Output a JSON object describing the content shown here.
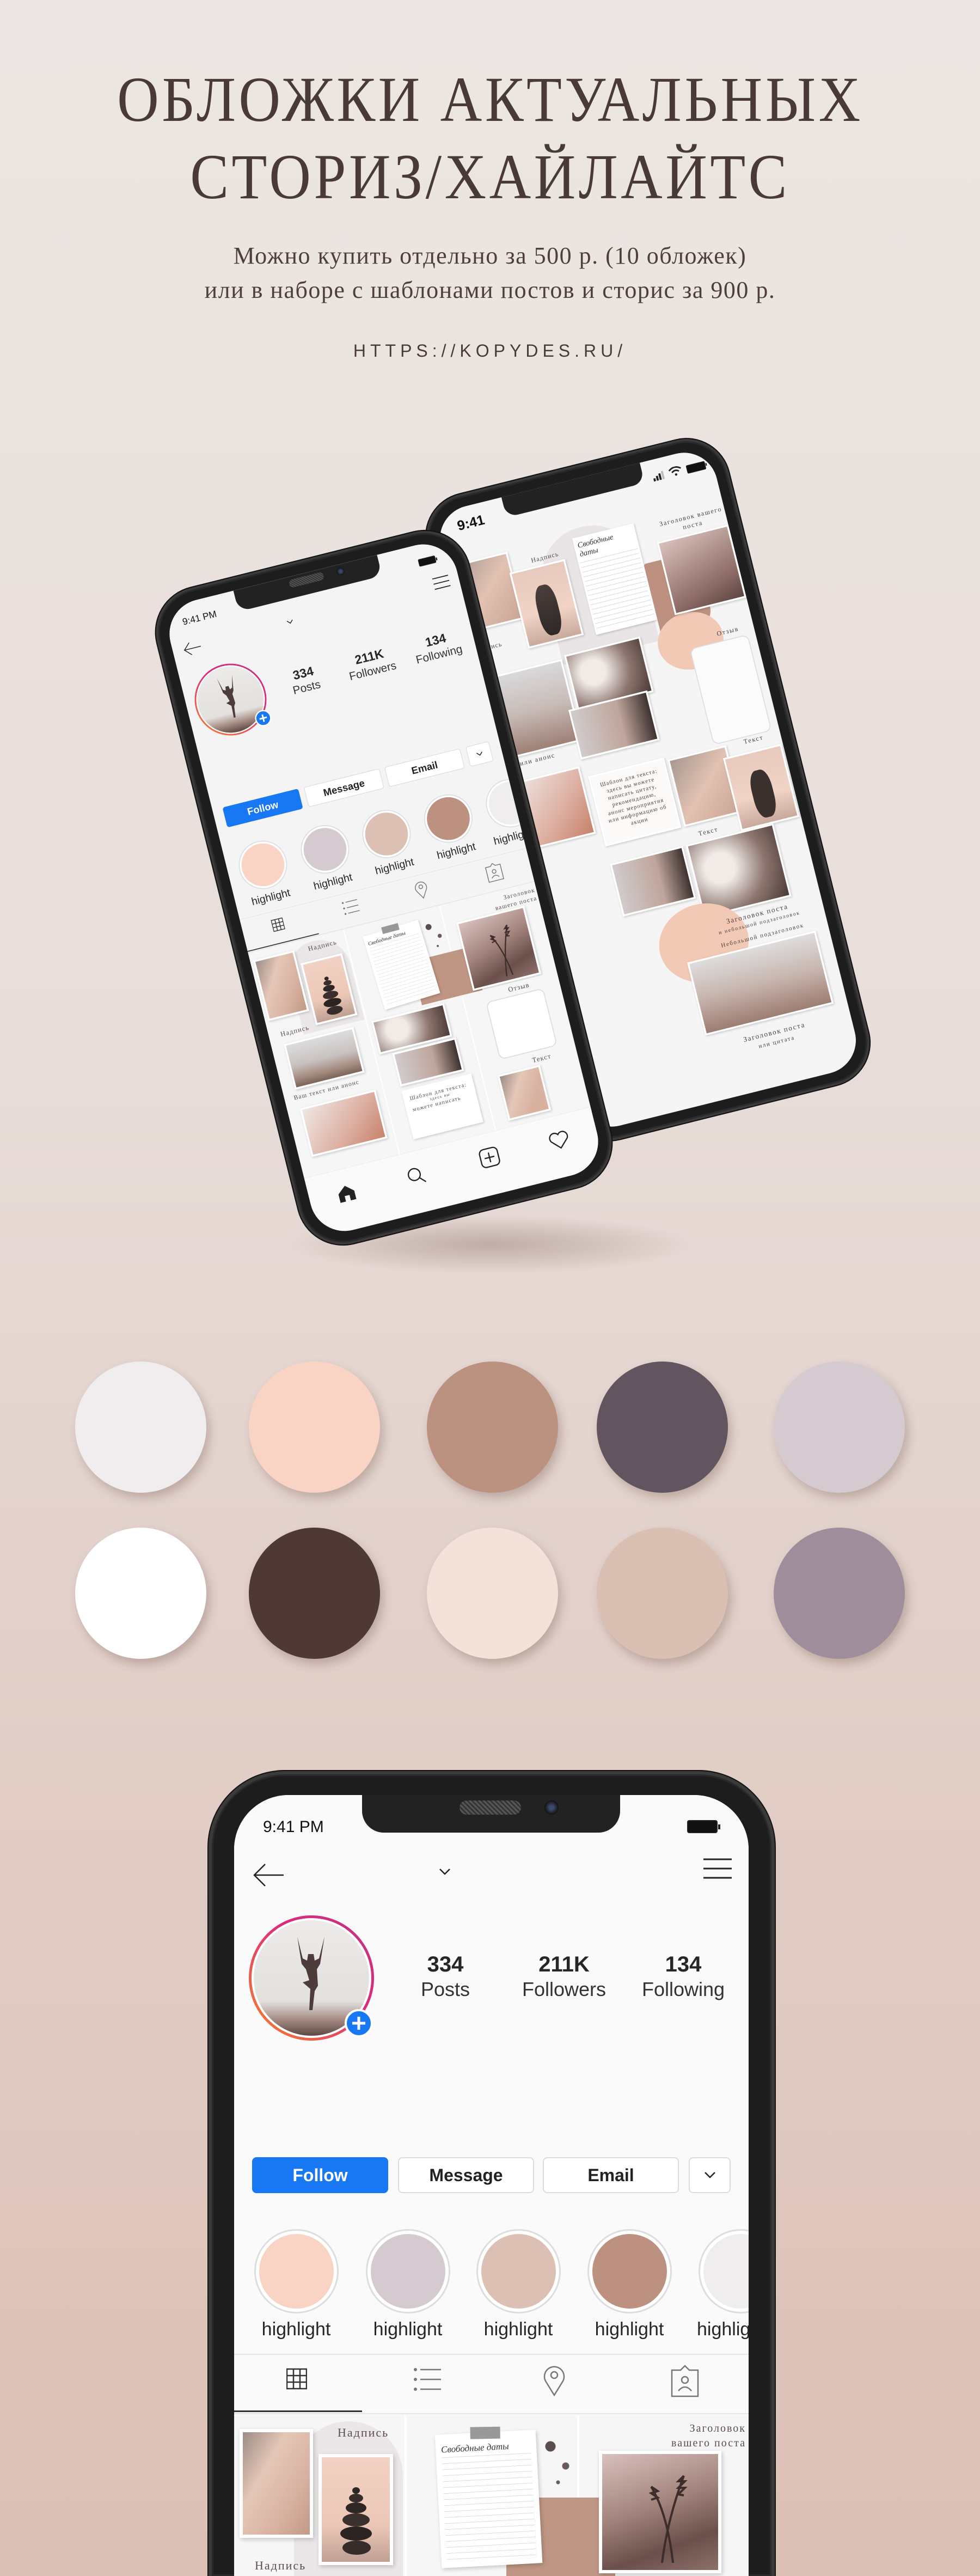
{
  "header": {
    "title_lines": [
      "ОБЛОЖКИ АКТУАЛЬНЫХ",
      "СТОРИЗ/ХАЙЛАЙТС"
    ],
    "subtitle_lines": [
      "Можно купить отдельно за 500 р. (10 обложек)",
      "или в наборе с шаблонами постов и сторис за 900 р."
    ],
    "url": "HTTPS://KOPYDES.RU/"
  },
  "palette": {
    "rows": [
      [
        "#f0edee",
        "#f9d3c4",
        "#bb917f",
        "#625560",
        "#d6cad1"
      ],
      [
        "#ffffff",
        "#4f3934",
        "#f4e2da",
        "#dabfb3",
        "#9f8d9b"
      ]
    ]
  },
  "profile": {
    "status_time": "9:41 PM",
    "icons": {
      "back": "arrow-left-icon",
      "username_dropdown": "chevron-down-icon",
      "menu": "hamburger-icon",
      "add_story": "plus-circle-icon",
      "battery": "battery-icon"
    },
    "stats": [
      {
        "value": "334",
        "label": "Posts"
      },
      {
        "value": "211K",
        "label": "Followers"
      },
      {
        "value": "134",
        "label": "Following"
      }
    ],
    "buttons": {
      "follow": "Follow",
      "message": "Message",
      "email": "Email"
    },
    "accent_color": "#1877f2",
    "highlights": [
      {
        "label": "highlight",
        "color": "#f9d3c4"
      },
      {
        "label": "highlight",
        "color": "#d6cad1"
      },
      {
        "label": "highlight",
        "color": "#dcc0b4"
      },
      {
        "label": "highlight",
        "color": "#bc917f"
      },
      {
        "label": "highlight",
        "color": "#f0edee"
      }
    ],
    "tabs": [
      "grid-icon",
      "list-icon",
      "location-pin-icon",
      "tagged-user-icon"
    ],
    "posts": {
      "caption_a": "Надпись",
      "caption_b": "Надпись",
      "notepad_title": "Свободные даты",
      "post_title_1": "Заголовок",
      "post_title_2": "вашего поста",
      "announce": "Ваш текст или анонс",
      "review": "Отзыв",
      "text": "Текст",
      "template_1": "Шаблон для текста:",
      "template_2": "здесь вы",
      "template_3": "можете написать"
    },
    "nav": [
      "home-icon",
      "search-icon",
      "add-post-icon",
      "heart-icon"
    ]
  },
  "feed_phone": {
    "status_time": "9:41",
    "captions": {
      "nadpis_1": "Надпись",
      "nadpis_2": "Надпись",
      "notepad": "Свободные даты",
      "post_title": "Заголовок вашего поста",
      "review": "Отзыв",
      "announce": "или анонс",
      "template": "Шаблон для текста: здесь вы можете написать цитату, рекомендацию, анонс мероприятия или информацию об акции",
      "text_1": "Текст",
      "text_2": "Текст",
      "post_heading": "Заголовок поста",
      "post_sub": "и небольшой подзаголовок",
      "small_sub": "Небольшой подзаголовок",
      "post_heading_2": "Заголовок поста",
      "quote": "или цитата"
    }
  }
}
